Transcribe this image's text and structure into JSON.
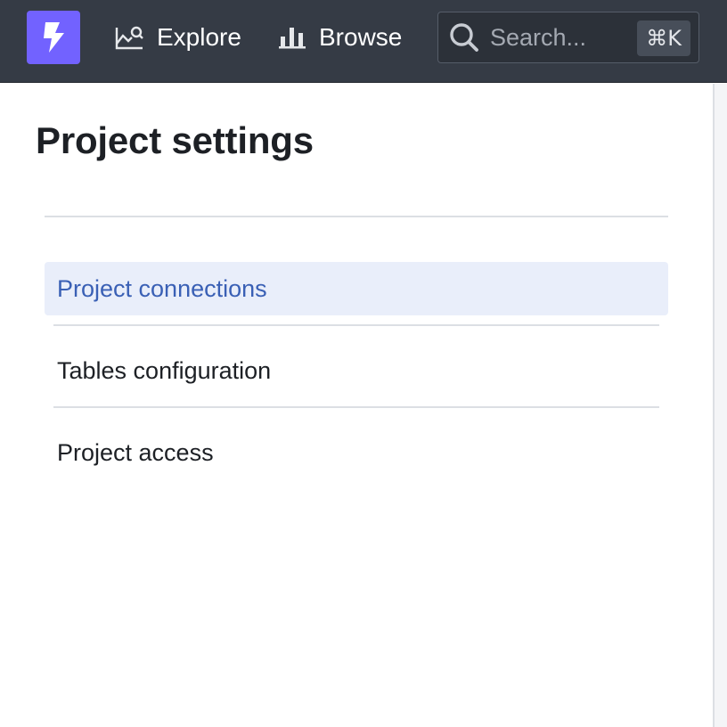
{
  "topbar": {
    "logo_icon": "lightning-bolt-icon",
    "brand_color": "#7262ff",
    "nav": {
      "explore_label": "Explore",
      "explore_icon": "chart-search-icon",
      "browse_label": "Browse",
      "browse_icon": "bar-chart-icon"
    },
    "search": {
      "placeholder": "Search...",
      "icon": "search-icon",
      "shortcut": "⌘K"
    }
  },
  "page": {
    "title": "Project settings"
  },
  "menu": {
    "items": [
      {
        "label": "Project connections",
        "active": true
      },
      {
        "label": "Tables configuration",
        "active": false
      },
      {
        "label": "Project access",
        "active": false
      }
    ]
  }
}
